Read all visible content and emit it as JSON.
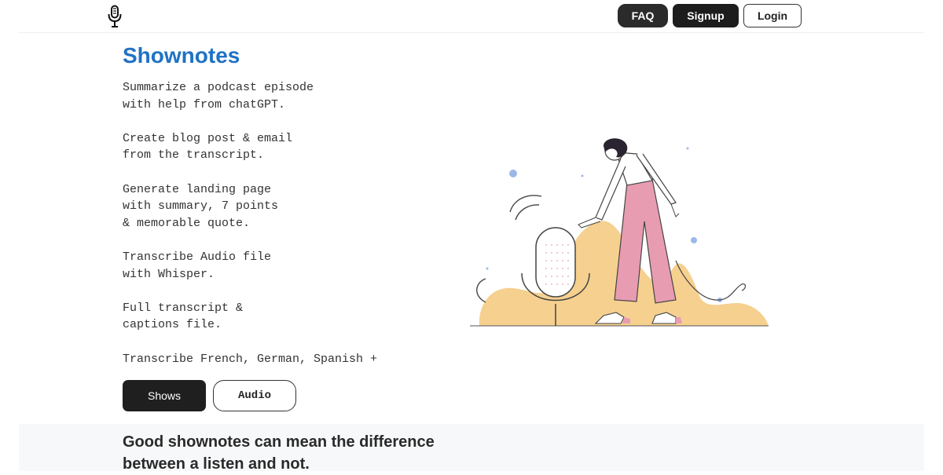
{
  "nav": {
    "faq_label": "FAQ",
    "signup_label": "Signup",
    "login_label": "Login"
  },
  "hero": {
    "title": "Shownotes",
    "features": [
      "Summarize a podcast episode\nwith help from chatGPT.",
      "Create blog post & email\nfrom the transcript.",
      "Generate landing page\nwith summary, 7 points\n& memorable quote.",
      "Transcribe Audio file\nwith Whisper.",
      "Full transcript &\ncaptions file.",
      "Transcribe French, German, Spanish +"
    ],
    "shows_label": "Shows",
    "audio_label": "Audio"
  },
  "section": {
    "headline": "Good shownotes can mean the difference between a listen and not."
  },
  "colors": {
    "brand_title": "#1f72c4",
    "dark_button": "#1f1f1f",
    "blob": "#f6d08f",
    "pants": "#e89cb1",
    "dots": "#9db8e8"
  },
  "icons": [
    "microphone-icon"
  ]
}
